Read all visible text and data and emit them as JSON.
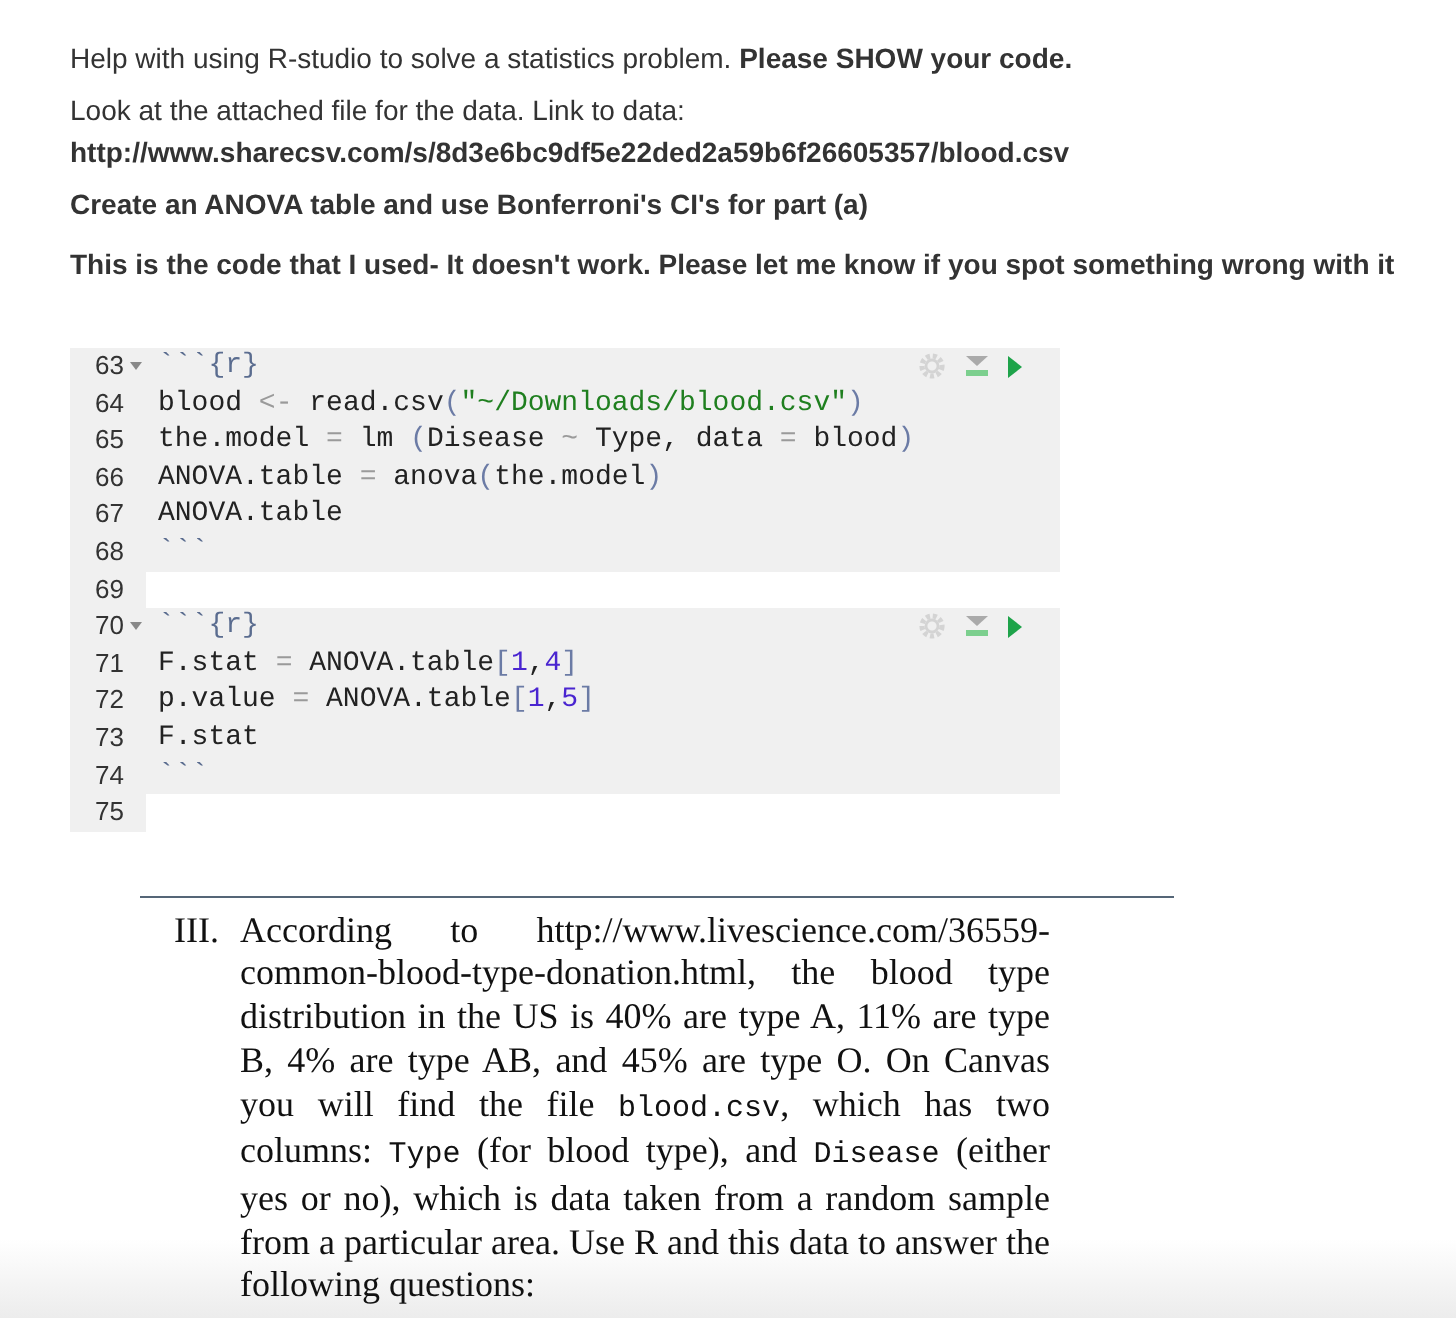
{
  "question": {
    "paragraphs": [
      {
        "text": "Help with using R-studio to solve a statistics problem. **Please SHOW your code.**",
        "bold": false
      },
      {
        "text": "Look at the attached file for the data. Link to data:",
        "bold": false
      },
      {
        "text": "http://www.sharecsv.com/s/8d3e6bc9df5e22ded2a59b6f26605357/blood.csv",
        "bold": true
      },
      {
        "text": "Create an ANOVA table and use Bonferroni's CI's for part (a)",
        "bold": true
      },
      {
        "text": "This is the code that I used- It doesn't work. Please let me know if you spot something wrong with it",
        "bold": true
      }
    ]
  },
  "code_editor": {
    "lines": [
      {
        "number": "63",
        "foldable": true,
        "in_chunk": true,
        "tokens": [
          {
            "kind": "fence",
            "text": "```{r}"
          }
        ]
      },
      {
        "number": "64",
        "foldable": false,
        "in_chunk": true,
        "tokens": [
          {
            "kind": "text",
            "text": "blood "
          },
          {
            "kind": "operator",
            "text": "<-"
          },
          {
            "kind": "text",
            "text": " read.csv"
          },
          {
            "kind": "paren",
            "text": "("
          },
          {
            "kind": "string",
            "text": "\"~/Downloads/blood.csv\""
          },
          {
            "kind": "paren",
            "text": ")"
          }
        ]
      },
      {
        "number": "65",
        "foldable": false,
        "in_chunk": true,
        "tokens": [
          {
            "kind": "text",
            "text": "the.model "
          },
          {
            "kind": "operator",
            "text": "="
          },
          {
            "kind": "text",
            "text": " lm "
          },
          {
            "kind": "paren",
            "text": "("
          },
          {
            "kind": "text",
            "text": "Disease "
          },
          {
            "kind": "operator",
            "text": "~"
          },
          {
            "kind": "text",
            "text": " Type, data "
          },
          {
            "kind": "operator",
            "text": "="
          },
          {
            "kind": "text",
            "text": " blood"
          },
          {
            "kind": "paren",
            "text": ")"
          }
        ]
      },
      {
        "number": "66",
        "foldable": false,
        "in_chunk": true,
        "tokens": [
          {
            "kind": "text",
            "text": "ANOVA.table "
          },
          {
            "kind": "operator",
            "text": "="
          },
          {
            "kind": "text",
            "text": " anova"
          },
          {
            "kind": "paren",
            "text": "("
          },
          {
            "kind": "text",
            "text": "the.model"
          },
          {
            "kind": "paren",
            "text": ")"
          }
        ]
      },
      {
        "number": "67",
        "foldable": false,
        "in_chunk": true,
        "tokens": [
          {
            "kind": "text",
            "text": "ANOVA.table"
          }
        ]
      },
      {
        "number": "68",
        "foldable": false,
        "in_chunk": true,
        "tokens": [
          {
            "kind": "fence",
            "text": "```"
          }
        ]
      },
      {
        "number": "69",
        "foldable": false,
        "in_chunk": false
      },
      {
        "number": "70",
        "foldable": true,
        "in_chunk": true,
        "tokens": [
          {
            "kind": "fence",
            "text": "```{r}"
          }
        ]
      },
      {
        "number": "71",
        "foldable": false,
        "in_chunk": true,
        "tokens": [
          {
            "kind": "text",
            "text": "F.stat "
          },
          {
            "kind": "operator",
            "text": "="
          },
          {
            "kind": "text",
            "text": " ANOVA.table"
          },
          {
            "kind": "paren",
            "text": "["
          },
          {
            "kind": "number",
            "text": "1"
          },
          {
            "kind": "text",
            "text": ","
          },
          {
            "kind": "number",
            "text": "4"
          },
          {
            "kind": "paren",
            "text": "]"
          }
        ]
      },
      {
        "number": "72",
        "foldable": false,
        "in_chunk": true,
        "tokens": [
          {
            "kind": "text",
            "text": "p.value "
          },
          {
            "kind": "operator",
            "text": "="
          },
          {
            "kind": "text",
            "text": " ANOVA.table"
          },
          {
            "kind": "paren",
            "text": "["
          },
          {
            "kind": "number",
            "text": "1"
          },
          {
            "kind": "text",
            "text": ","
          },
          {
            "kind": "number",
            "text": "5"
          },
          {
            "kind": "paren",
            "text": "]"
          }
        ]
      },
      {
        "number": "73",
        "foldable": false,
        "in_chunk": true,
        "tokens": [
          {
            "kind": "text",
            "text": "F.stat"
          }
        ]
      },
      {
        "number": "74",
        "foldable": false,
        "in_chunk": true,
        "tokens": [
          {
            "kind": "fence",
            "text": "```"
          }
        ]
      },
      {
        "number": "75",
        "foldable": false,
        "in_chunk": false
      }
    ]
  },
  "assignment": {
    "label": "III.",
    "segments": [
      {
        "kind": "text",
        "text": "According to http://www.livescience.com/36559-common-blood-type-donation.html, the blood type distribution in the US is 40% are type A, 11% are type B, 4% are type AB, and 45% are type O. On Canvas you will find the file "
      },
      {
        "kind": "code",
        "text": "blood.csv"
      },
      {
        "kind": "text",
        "text": ", which has two columns: "
      },
      {
        "kind": "code",
        "text": "Type"
      },
      {
        "kind": "text",
        "text": " (for blood type), and "
      },
      {
        "kind": "code",
        "text": "Disease"
      },
      {
        "kind": "text",
        "text": " (either yes or no), which is data taken from a random sample from a particular area. Use R and this data to answer the following questions:"
      }
    ]
  }
}
